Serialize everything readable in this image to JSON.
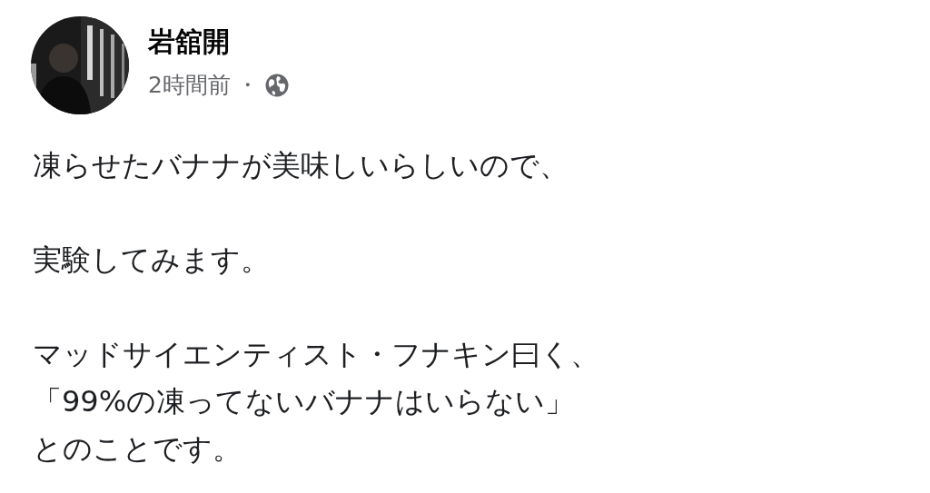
{
  "post": {
    "author": "岩舘開",
    "time": "2時間前",
    "separator": "・",
    "paragraphs": [
      [
        "凍らせたバナナが美味しいらしいので、"
      ],
      [
        "実験してみます。"
      ],
      [
        "マッドサイエンティスト・フナキン曰く、",
        "「99%の凍ってないバナナはいらない」",
        "とのことです。"
      ]
    ]
  }
}
